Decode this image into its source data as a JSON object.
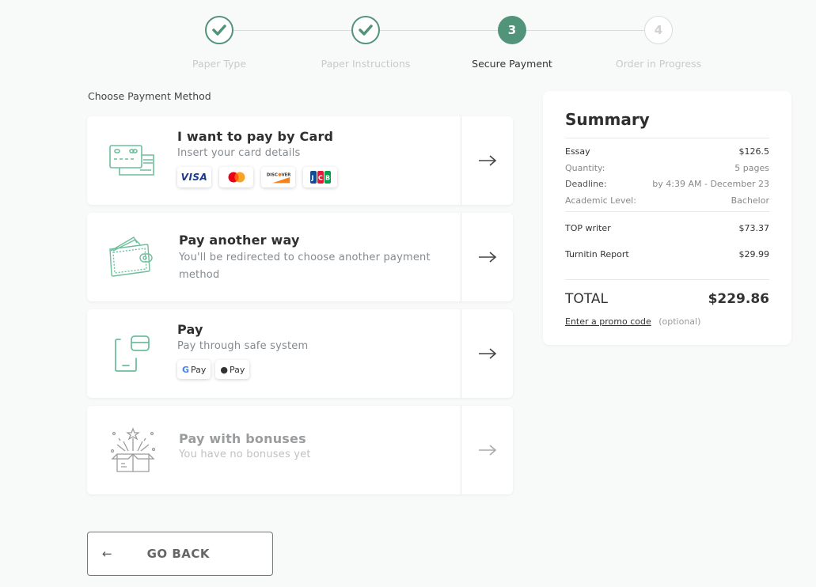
{
  "stepper": {
    "steps": [
      {
        "label": "Paper Type",
        "state": "done",
        "marker": "✔"
      },
      {
        "label": "Paper Instructions",
        "state": "done",
        "marker": "✔"
      },
      {
        "label": "Secure Payment",
        "state": "active",
        "marker": "3"
      },
      {
        "label": "Order in Progress",
        "state": "pending",
        "marker": "4"
      }
    ]
  },
  "payment": {
    "section_label": "Choose Payment Method",
    "methods": [
      {
        "title": "I want to pay by Card",
        "subtitle": "Insert your card details",
        "icon": "credit-card-icon",
        "badges": [
          "VISA",
          "Mastercard",
          "DISCOVER",
          "JCB"
        ]
      },
      {
        "title": "Pay another way",
        "subtitle": "You'll be redirected to choose another payment method",
        "icon": "wallet-icon"
      },
      {
        "title": "Pay",
        "subtitle": "Pay through safe system",
        "icon": "phone-card-icon",
        "badges": [
          "G Pay",
          " Pay"
        ]
      },
      {
        "title": "Pay with bonuses",
        "subtitle": "You have no bonuses yet",
        "icon": "gift-box-icon",
        "disabled": true
      }
    ],
    "arrow_glyph": "→"
  },
  "go_back": {
    "arrow": "←",
    "label": "GO BACK"
  },
  "summary": {
    "title": "Summary",
    "item": {
      "label": "Essay",
      "value": "$126.5"
    },
    "details": [
      {
        "label": "Quantity:",
        "value": "5 pages"
      },
      {
        "label": "Deadline:",
        "value": "by 4:39 AM - December 23"
      },
      {
        "label": "Academic Level:",
        "value": "Bachelor"
      }
    ],
    "extras": [
      {
        "label": "TOP writer",
        "value": "$73.37"
      },
      {
        "label": "Turnitin Report",
        "value": "$29.99"
      }
    ],
    "total_label": "TOTAL",
    "total_value": "$229.86",
    "promo_link": "Enter a promo code",
    "promo_note": "(optional)"
  },
  "colors": {
    "accent": "#519479",
    "icon": "#6dbf9c"
  }
}
